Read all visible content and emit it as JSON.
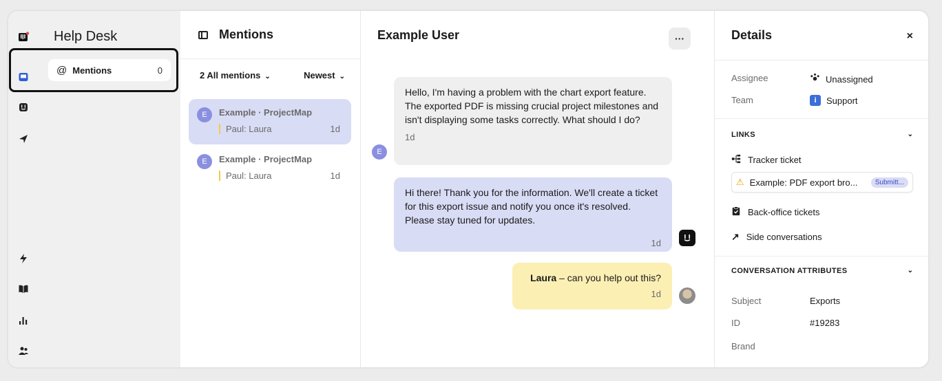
{
  "nav": {
    "title": "Help Desk",
    "mentions_label": "Mentions",
    "mentions_count": "0"
  },
  "list": {
    "title": "Mentions",
    "filter_all": "2 All mentions",
    "filter_sort": "Newest",
    "items": [
      {
        "avatar": "E",
        "title": "Example · ProjectMap",
        "snippet": "Paul: Laura",
        "time": "1d"
      },
      {
        "avatar": "E",
        "title": "Example · ProjectMap",
        "snippet": "Paul: Laura",
        "time": "1d"
      }
    ]
  },
  "chat": {
    "title": "Example User",
    "more": "···",
    "user_avatar": "E",
    "messages": [
      {
        "text": "Hello, I'm having a problem with the chart export feature. The exported PDF is missing crucial project milestones and isn't displaying some tasks correctly. What should I do?",
        "time": "1d"
      },
      {
        "text": "Hi there! Thank you for the information. We'll create a ticket for this export issue and notify you once it's resolved. Please stay tuned for updates.",
        "time": "1d"
      },
      {
        "mention": "Laura",
        "text": " – can you help out this?",
        "time": "1d"
      }
    ]
  },
  "details": {
    "title": "Details",
    "close": "×",
    "assignee_label": "Assignee",
    "assignee_value": "Unassigned",
    "team_label": "Team",
    "team_value": "Support",
    "links_title": "LINKS",
    "tracker_label": "Tracker ticket",
    "ticket_title": "Example: PDF export bro...",
    "ticket_status": "Submitt...",
    "backoffice_label": "Back-office tickets",
    "side_label": "Side conversations",
    "attrs_title": "CONVERSATION ATTRIBUTES",
    "subject_label": "Subject",
    "subject_value": "Exports",
    "id_label": "ID",
    "id_value": "#19283",
    "brand_label": "Brand"
  },
  "colors": {
    "accent": "#d9dcf5",
    "mention": "#fcefb4",
    "avatar": "#8b8fe0",
    "rail": "#f0f0f0"
  }
}
